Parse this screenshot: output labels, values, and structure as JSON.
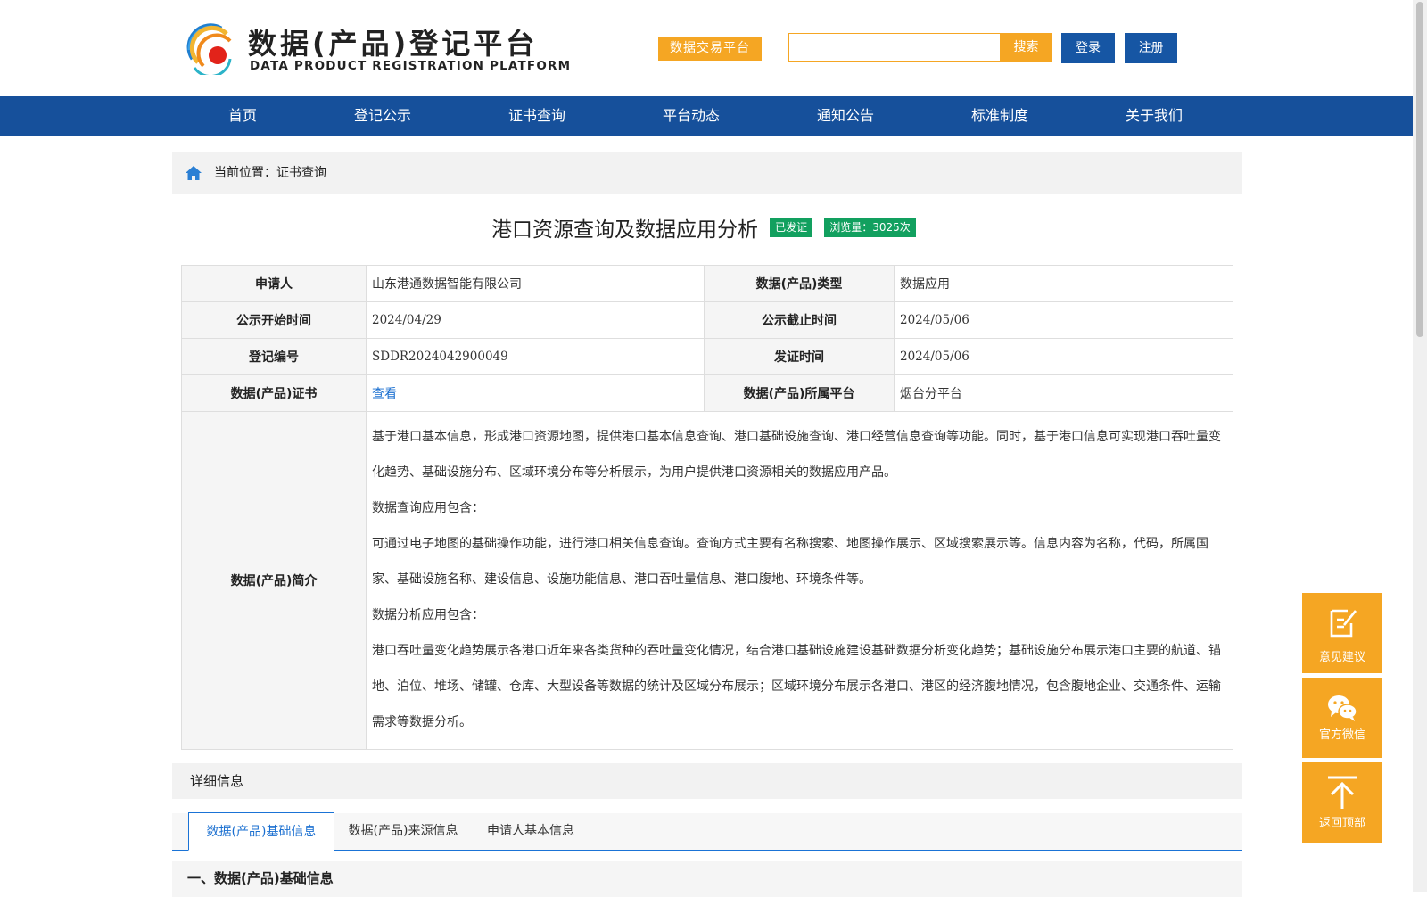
{
  "header": {
    "logo_cn": "数据(产品)登记平台",
    "logo_en": "DATA PRODUCT REGISTRATION PLATFORM",
    "trade_button": "数据交易平台",
    "search": {
      "value": "",
      "placeholder": "",
      "button": "搜索"
    },
    "login": "登录",
    "register": "注册"
  },
  "nav": {
    "items": [
      "首页",
      "登记公示",
      "证书查询",
      "平台动态",
      "通知公告",
      "标准制度",
      "关于我们"
    ]
  },
  "breadcrumb": {
    "text": "当前位置：证书查询"
  },
  "product": {
    "title": "港口资源查询及数据应用分析",
    "status_badge": "已发证",
    "views_badge": "浏览量：3025次"
  },
  "info": {
    "applicant_label": "申请人",
    "applicant": "山东港通数据智能有限公司",
    "type_label": "数据(产品)类型",
    "type": "数据应用",
    "start_label": "公示开始时间",
    "start": "2024/04/29",
    "end_label": "公示截止时间",
    "end": "2024/05/06",
    "reg_no_label": "登记编号",
    "reg_no": "SDDR2024042900049",
    "issue_label": "发证时间",
    "issue": "2024/05/06",
    "cert_label": "数据(产品)证书",
    "cert_link": "查看",
    "platform_label": "数据(产品)所属平台",
    "platform": "烟台分平台",
    "desc_label": "数据(产品)简介",
    "desc": [
      "基于港口基本信息，形成港口资源地图，提供港口基本信息查询、港口基础设施查询、港口经营信息查询等功能。同时，基于港口信息可实现港口吞吐量变化趋势、基础设施分布、区域环境分布等分析展示，为用户提供港口资源相关的数据应用产品。",
      "数据查询应用包含：",
      "可通过电子地图的基础操作功能，进行港口相关信息查询。查询方式主要有名称搜索、地图操作展示、区域搜索展示等。信息内容为名称，代码，所属国家、基础设施名称、建设信息、设施功能信息、港口吞吐量信息、港口腹地、环境条件等。",
      "数据分析应用包含：",
      "港口吞吐量变化趋势展示各港口近年来各类货种的吞吐量变化情况，结合港口基础设施建设基础数据分析变化趋势；基础设施分布展示港口主要的航道、锚地、泊位、堆场、储罐、仓库、大型设备等数据的统计及区域分布展示；区域环境分布展示各港口、港区的经济腹地情况，包含腹地企业、交通条件、运输需求等数据分析。"
    ]
  },
  "detail": {
    "title": "详细信息",
    "tabs": [
      "数据(产品)基础信息",
      "数据(产品)来源信息",
      "申请人基本信息"
    ],
    "active_tab": 0,
    "section_title": "一、数据(产品)基础信息"
  },
  "float": {
    "feedback": "意见建议",
    "wechat": "官方微信",
    "top": "返回顶部"
  },
  "colors": {
    "nav_blue": "#16509b",
    "button_blue": "#1656a4",
    "accent_orange": "#f5a623",
    "badge_green": "#12a05f",
    "link_blue": "#1a6fd0"
  }
}
